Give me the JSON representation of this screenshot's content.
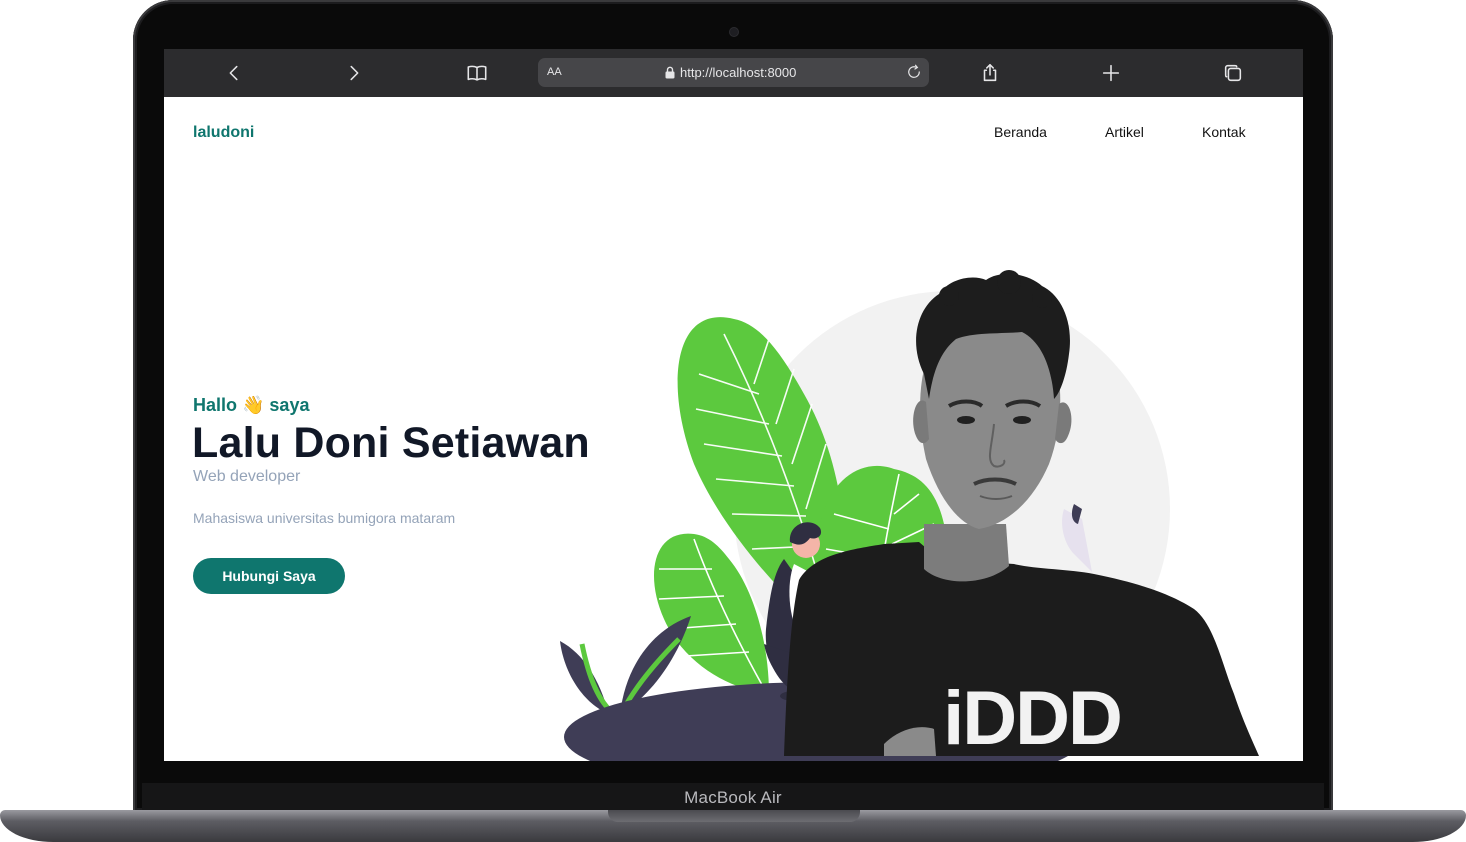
{
  "device": {
    "label": "MacBook Air"
  },
  "browser": {
    "text_size_label": "AA",
    "url": "http://localhost:8000",
    "icons": [
      "back-icon",
      "forward-icon",
      "bookmarks-icon",
      "lock-icon",
      "reload-icon",
      "share-icon",
      "new-tab-icon",
      "tabs-icon"
    ]
  },
  "site": {
    "logo": "laludoni",
    "nav": [
      {
        "label": "Beranda"
      },
      {
        "label": "Artikel"
      },
      {
        "label": "Kontak"
      }
    ]
  },
  "hero": {
    "greeting": "Hallo 👋 saya",
    "name": "Lalu Doni Setiawan",
    "role": "Web developer",
    "description": "Mahasiswa universitas bumigora mataram",
    "cta_label": "Hubungi Saya",
    "shirt_text": "iDDD"
  },
  "colors": {
    "accent": "#0f766e",
    "heading": "#111827",
    "muted": "#94a3b8",
    "leaf": "#5cc93e",
    "ground": "#3f3d56",
    "circle": "#f2f2f2"
  }
}
